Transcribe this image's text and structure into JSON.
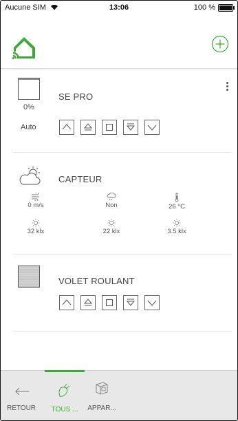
{
  "status": {
    "carrier": "Aucune SIM",
    "time": "13:06",
    "battery": "100 %",
    "battery_fraction": 1.0
  },
  "accent_color": "#3aaa35",
  "header": {
    "logo_icon": "home-wifi-icon",
    "add_icon": "plus-circle-icon"
  },
  "devices": {
    "se_pro": {
      "name": "SE PRO",
      "position": "0%",
      "mode": "Auto",
      "controls": [
        "arrow-up-icon",
        "raise-icon",
        "stop-icon",
        "lower-icon",
        "arrow-down-icon"
      ]
    },
    "capteur": {
      "name": "CAPTEUR",
      "readings": [
        {
          "icon": "wind-icon",
          "value": "0 m/s"
        },
        {
          "icon": "rain-icon",
          "value": "Non"
        },
        {
          "icon": "thermometer-icon",
          "value": "26 °C"
        },
        {
          "icon": "sun-icon",
          "value": "32 klx"
        },
        {
          "icon": "sun-icon",
          "value": "22 klx"
        },
        {
          "icon": "sun-icon",
          "value": "3.5 klx"
        }
      ]
    },
    "volet": {
      "name": "VOLET ROULANT",
      "controls": [
        "arrow-up-icon",
        "raise-icon",
        "stop-icon",
        "lower-icon",
        "arrow-down-icon"
      ]
    }
  },
  "tabbar": {
    "back": "RETOUR",
    "all": "TOUS ...",
    "devices": "APPAR..."
  }
}
